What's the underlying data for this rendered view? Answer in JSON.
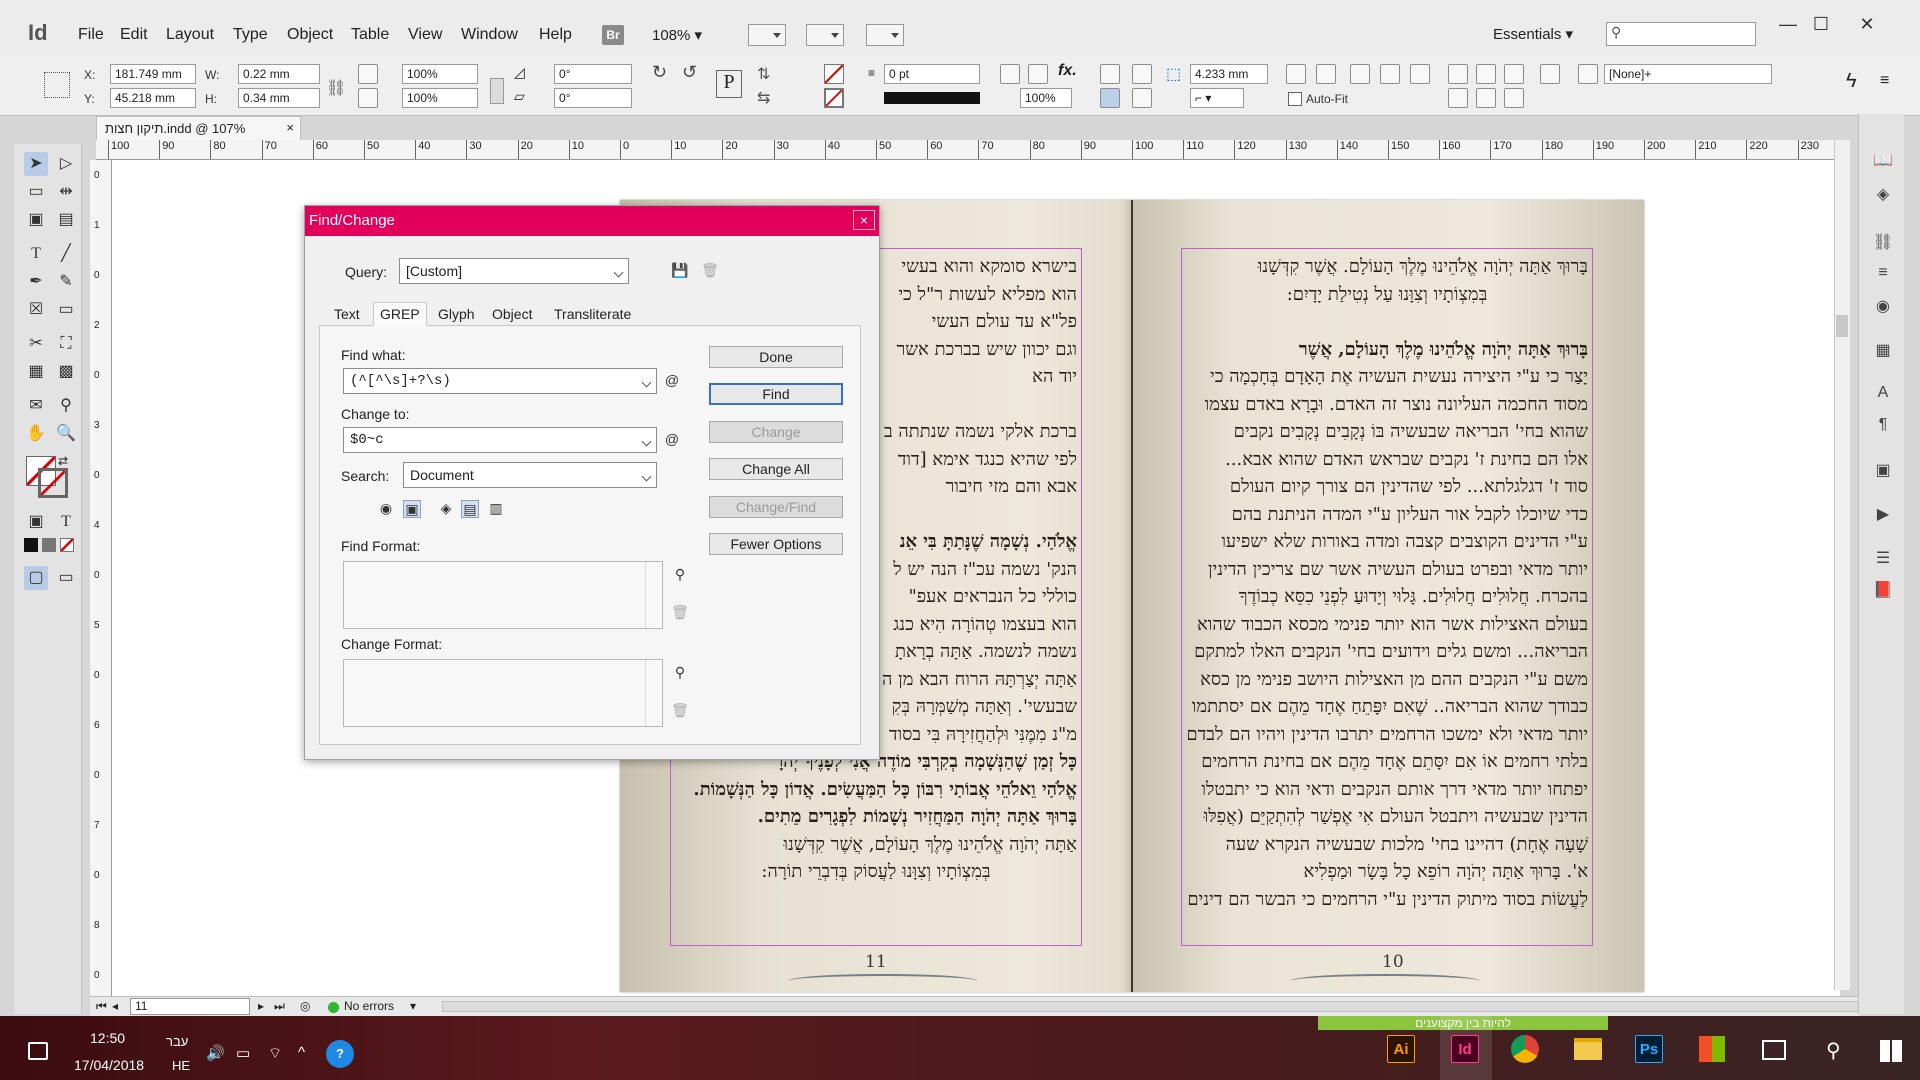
{
  "app": {
    "logo": "Id"
  },
  "menu": [
    "File",
    "Edit",
    "Layout",
    "Type",
    "Object",
    "Table",
    "View",
    "Window",
    "Help"
  ],
  "menubar": {
    "br_badge": "Br",
    "zoom": "108%",
    "workspace": "Essentials",
    "search_placeholder": ""
  },
  "window_controls": {
    "minimize": "—",
    "maximize": "☐",
    "close": "✕"
  },
  "control": {
    "x_label": "X:",
    "x_value": "181.749 mm",
    "y_label": "Y:",
    "y_value": "45.218 mm",
    "w_label": "W:",
    "w_value": "0.22 mm",
    "h_label": "H:",
    "h_value": "0.34 mm",
    "scale_x": "100%",
    "scale_y": "100%",
    "rotate": "0°",
    "shear": "0°",
    "stroke_weight": "0 pt",
    "opacity": "100%",
    "offset": "4.233 mm",
    "autofit_label": "Auto-Fit",
    "style_value": "[None]+"
  },
  "document": {
    "tab_title": "תיקון חצות.indd @ 107%",
    "tab_close": "×"
  },
  "ruler_top": [
    "100",
    "90",
    "80",
    "70",
    "60",
    "50",
    "40",
    "30",
    "20",
    "10",
    "0",
    "10",
    "20",
    "30",
    "40",
    "50",
    "60",
    "70",
    "80",
    "90",
    "100",
    "110",
    "120",
    "130",
    "140",
    "150",
    "160",
    "170",
    "180",
    "190",
    "200",
    "210",
    "220",
    "230"
  ],
  "ruler_left": [
    "0",
    "1",
    "0",
    "2",
    "0",
    "3",
    "0",
    "4",
    "0",
    "5",
    "0",
    "6",
    "0",
    "7",
    "0",
    "8",
    "0"
  ],
  "pages": {
    "left_number": "11",
    "right_number": "10",
    "left_lines": [
      {
        "t": "בישרא סומקא והוא בעשי",
        "b": false
      },
      {
        "t": "הוא מפליא לעשות ר\"ל כי",
        "b": false
      },
      {
        "t": "פל\"א עד עולם העשי",
        "b": false
      },
      {
        "t": "וגם יכוון שיש בברכת אשר",
        "b": false
      },
      {
        "t": "יוד הא",
        "b": false
      },
      {
        "t": "",
        "b": false
      },
      {
        "t": "ברכת אלקי נשמה שנתתה ב",
        "b": false
      },
      {
        "t": "לפי שהיא כנגד אימא [דוד",
        "b": false
      },
      {
        "t": "אבא והם מזי חיבור",
        "b": false
      },
      {
        "t": "",
        "b": false
      },
      {
        "t": "אֱלֹהַי. נְשָׁמָה שֶׁנָּתַתָּ בִּי אֵנ",
        "b": true
      },
      {
        "t": "הנק' נשמה עכ\"ז הנה יש ל",
        "b": false
      },
      {
        "t": "כוללי כל הנבראים אעפ\"",
        "b": false
      },
      {
        "t": "הוא בעצמו טְהוֹרָה הִיא כנג",
        "b": false
      },
      {
        "t": "נשמה לנשמה. אַתָּה בְרָאתָ",
        "b": false
      },
      {
        "t": "אַתָּה יְצַרְתָּהּ הרוח הבא מן ה",
        "b": false
      },
      {
        "t": "שבעשי'. וְאַתָּה מְשַׁמְּרָהּ בְּקִ",
        "b": false
      },
      {
        "t": "מ\"נ מִמֶּנִּי וּלְהַחֲזִירָהּ בִּי בסוד",
        "b": false
      },
      {
        "t": "כָּל זְמַן שֶׁהַנְּשָׁמָה בְקִרְבִּי מוֹדֶה אֲנִי לְפָנֶיךָ יְהֹוָ",
        "b": true
      },
      {
        "t": "אֱלֹהַי וֵאלֹהֵי אֲבוֹתַי רִבּוֹן כָּל הַמַּעֲשִׂים. אֲדוֹן כָּל הַנְּשָׁמוֹת.",
        "b": true
      },
      {
        "t": "בָּרוּךְ אַתָּה יְהֹוָה הַמַּחֲזִיר נְשָׁמוֹת לִפְגָרִים מֵתִים.",
        "b": true
      },
      {
        "t": "אַתָּה יְהֹוָה אֱלֹהֵינוּ מֶלֶךְ הָעוֹלָם, אֲשֶׁר קִדְּשָׁנוּ",
        "b": false
      },
      {
        "t": "בְּמִצְוֹתָיו וְצִוָּנוּ לַעֲסוֹק בְּדִבְרֵי תוֹרָה:",
        "b": false,
        "c": true
      }
    ],
    "right_lines": [
      {
        "t": "בָּרוּךְ אַתָּה יְהֹוָה אֱלֹהֵינוּ מֶלֶךְ הָעוֹלָם. אֲשֶׁר קִדְּשָׁנוּ",
        "b": false
      },
      {
        "t": "בְּמִצְוֹתָיו וְצִוָּנוּ עַל נְטִילַת יָדָיִם:",
        "b": false,
        "c": true
      },
      {
        "t": "",
        "b": false
      },
      {
        "t": "בָּרוּךְ אַתָּה יְהֹוָה אֱלֹהֵינוּ מֶלֶךְ הָעוֹלָם, אֲשֶׁר",
        "b": true
      },
      {
        "t": "יָצַר כי ע\"י היצירה נעשית העשיה אֶת הָאָדָם בְּחָכְמָה כי",
        "b": false
      },
      {
        "t": "מסוד החכמה העליונה נוצר זה האדם. וּבָרָא באדם עצמו",
        "b": false
      },
      {
        "t": "שהוא בחי' הבריאה שבעשיה בּוֹ נְקָבִים נְקָבִים נקבים",
        "b": false
      },
      {
        "t": "אלו הם בחינת ז' נקבים שבראש האדם שהוא אבא...",
        "b": false
      },
      {
        "t": "סוד ז' דגלגלתא... לפי שהדינין הם צורך קיום העולם",
        "b": false
      },
      {
        "t": "כדי שיוכלו לקבל אור העליון ע\"י המדה הניתנת בהם",
        "b": false
      },
      {
        "t": "ע\"י הדינים הקוצבים קצבה ומדה באורות שלא ישפיעו",
        "b": false
      },
      {
        "t": "יותר מדאי ובפרט בעולם העשיה אשר שם צריכין הדינין",
        "b": false
      },
      {
        "t": "בהכרח. חֲלוּלִים חֲלוּלִים. גָּלוּי וְיָדוּעַ לִפְנֵי כִסֵּא כְבוֹדֶךָ",
        "b": false
      },
      {
        "t": "בעולם האצילות אשר הוא יותר פנימי מכסא הכבוד שהוא",
        "b": false
      },
      {
        "t": "הבריאה... ומשם גלים וידועים בחי' הנקבים האלו למתקם",
        "b": false
      },
      {
        "t": "משם ע\"י הנקבים ההם מן האצילות היושב פנימי מן כסא",
        "b": false
      },
      {
        "t": "כבודך שהוא הבריאה.. שֶׁאִם יִפָּתֵחַ אֶחָד מֵהֶם אם יסתתמו",
        "b": false
      },
      {
        "t": "יותר מדאי ולא ימשכו הרחמים יתרבו הדינין ויהיו הם לבדם",
        "b": false
      },
      {
        "t": "בלתי רחמים אוֹ אִם יִסָּתֵם אֶחָד מֵהֶם אם בחינת הרחמים",
        "b": false
      },
      {
        "t": "יפתחו יותר מדאי דרך אותם הנקבים ודאי הוא כי יתבטלו",
        "b": false
      },
      {
        "t": "הדינין שבעשיה ויתבטל העולם אִי אֶפְשַׁר לְהִתְקַיֵּם (אֲפִלּוּ",
        "b": false
      },
      {
        "t": "שָׁעָה אֶחָת) דהיינו בחי' מלכות שבעשיה הנקרא שעה",
        "b": false
      },
      {
        "t": "א'. בָּרוּךְ אַתָּה יְהֹוָה רוֹפֵא כָל בָּשָׂר וּמַפְלִיא",
        "b": false
      },
      {
        "t": "לַעֲשׂוֹת בסוד מיתוק הדינין ע\"י הרחמים כי הבשר הם דינים",
        "b": false
      }
    ]
  },
  "dialog": {
    "title": "Find/Change",
    "close": "×",
    "query_label": "Query:",
    "query_value": "[Custom]",
    "tabs": [
      "Text",
      "GREP",
      "Glyph",
      "Object",
      "Transliterate"
    ],
    "active_tab": "GREP",
    "find_what_label": "Find what:",
    "find_what_value": "(^[^\\s]+?\\s)",
    "change_to_label": "Change to:",
    "change_to_value": "$0~c",
    "search_label": "Search:",
    "search_value": "Document",
    "find_format_label": "Find Format:",
    "change_format_label": "Change Format:",
    "buttons": {
      "done": "Done",
      "find": "Find",
      "change": "Change",
      "change_all": "Change All",
      "change_find": "Change/Find",
      "fewer_options": "Fewer Options"
    }
  },
  "status": {
    "page": "11",
    "errors": "No errors"
  },
  "taskbar": {
    "time": "12:50",
    "date": "17/04/2018",
    "lang_top": "עבר",
    "lang_bottom": "HE",
    "banner": "להיות בין מקצוענים",
    "apps": [
      "Ai",
      "Id",
      "Chrome",
      "Files",
      "Ps",
      "Store"
    ]
  }
}
